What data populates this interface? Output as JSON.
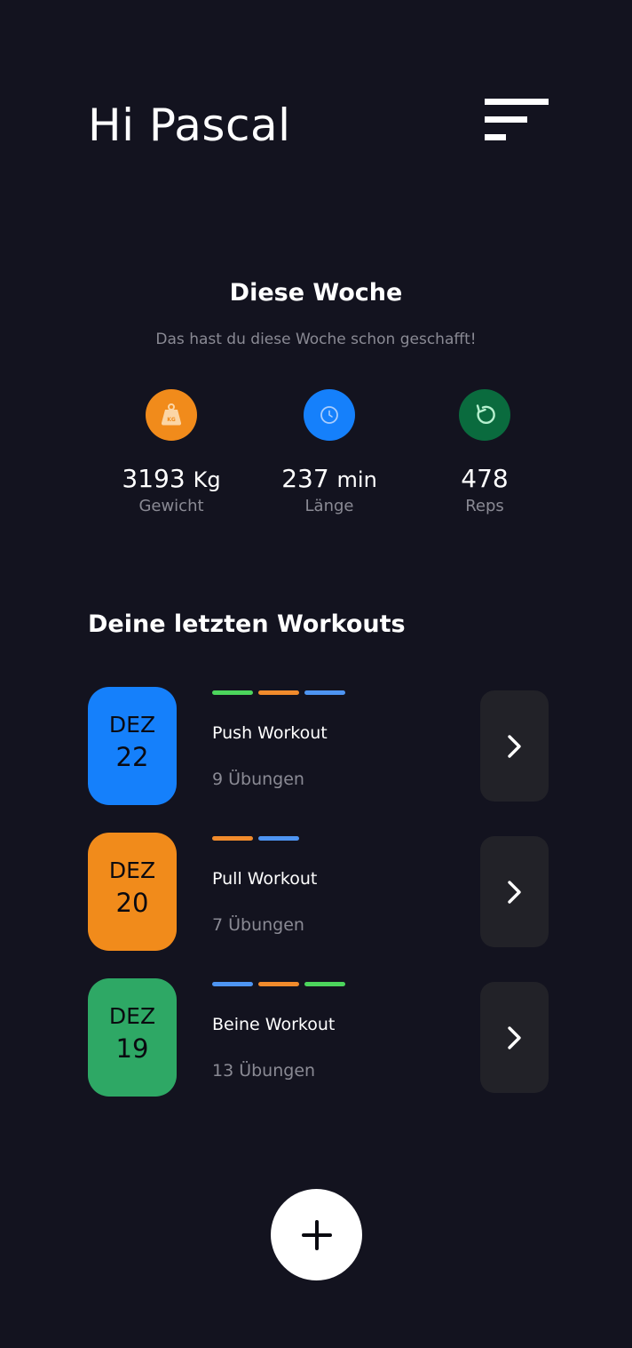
{
  "header": {
    "greeting": "Hi Pascal",
    "menu_icon": "menu-icon"
  },
  "week": {
    "title": "Diese Woche",
    "subtitle": "Das hast du diese Woche schon geschafft!",
    "stats": [
      {
        "icon": "weight-kg-icon",
        "color": "#f18b1b",
        "value": "3193",
        "unit": "Kg",
        "label": "Gewicht"
      },
      {
        "icon": "clock-icon",
        "color": "#1580fb",
        "value": "237",
        "unit": "min",
        "label": "Länge"
      },
      {
        "icon": "repeat-icon",
        "color": "#0a6b3e",
        "value": "478",
        "unit": "",
        "label": "Reps"
      }
    ]
  },
  "recent": {
    "title": "Deine letzten Workouts",
    "workouts": [
      {
        "month": "DEZ",
        "day": "22",
        "color": "#1580fb",
        "name": "Push Workout",
        "count": "9 Übungen",
        "tags": [
          "#4cd55c",
          "#f18b2c",
          "#4e95f2"
        ]
      },
      {
        "month": "DEZ",
        "day": "20",
        "color": "#f18b1b",
        "name": "Pull Workout",
        "count": "7 Übungen",
        "tags": [
          "#f18b2c",
          "#4e95f2"
        ]
      },
      {
        "month": "DEZ",
        "day": "19",
        "color": "#2ea865",
        "name": "Beine Workout",
        "count": "13 Übungen",
        "tags": [
          "#4e95f2",
          "#f18b2c",
          "#4cd55c"
        ]
      }
    ]
  },
  "actions": {
    "add_icon": "plus-icon",
    "arrow_icon": "chevron-right-icon"
  }
}
